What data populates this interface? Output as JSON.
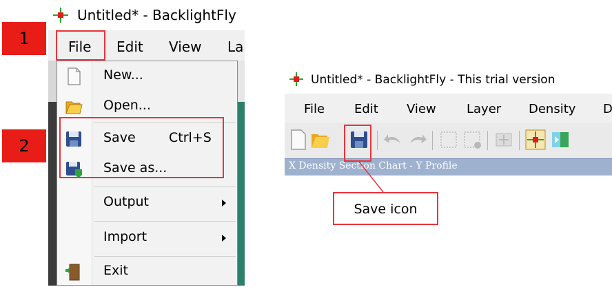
{
  "left": {
    "window_title": "Untitled* - BacklightFly",
    "menubar": [
      "File",
      "Edit",
      "View",
      "La"
    ],
    "file_menu": {
      "items": [
        {
          "label": "New...",
          "icon": "new-file-icon"
        },
        {
          "label": "Open...",
          "icon": "open-folder-icon"
        },
        {
          "label": "Save",
          "shortcut": "Ctrl+S",
          "icon": "save-disk-icon"
        },
        {
          "label": "Save as...",
          "icon": "save-as-icon"
        },
        {
          "label": "Output",
          "submenu": true
        },
        {
          "label": "Import",
          "submenu": true
        },
        {
          "label": "Exit",
          "icon": "exit-door-icon"
        }
      ]
    },
    "badges": [
      "1",
      "2"
    ]
  },
  "right": {
    "window_title": "Untitled* - BacklightFly - This trial version",
    "menubar": [
      "File",
      "Edit",
      "View",
      "Layer",
      "Density",
      "D"
    ],
    "panel_title": "X Density Section Chart - Y Profile",
    "callout": "Save icon"
  },
  "colors": {
    "highlight": "#e8343b",
    "badge": "#e81d18",
    "panel": "#9eb1cf"
  }
}
